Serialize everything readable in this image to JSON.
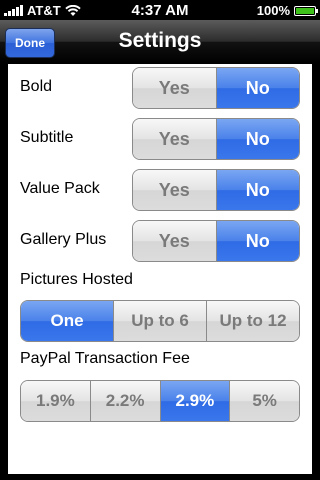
{
  "status_bar": {
    "carrier": "AT&T",
    "time": "4:37 AM",
    "battery": "100%"
  },
  "nav": {
    "title": "Settings",
    "done_label": "Done"
  },
  "options": [
    {
      "label": "Bold",
      "yes": "Yes",
      "no": "No",
      "selected": "No"
    },
    {
      "label": "Subtitle",
      "yes": "Yes",
      "no": "No",
      "selected": "No"
    },
    {
      "label": "Value Pack",
      "yes": "Yes",
      "no": "No",
      "selected": "No"
    },
    {
      "label": "Gallery Plus",
      "yes": "Yes",
      "no": "No",
      "selected": "No"
    }
  ],
  "pictures_hosted": {
    "label": "Pictures Hosted",
    "choices": [
      "One",
      "Up to 6",
      "Up to 12"
    ],
    "selected": "One"
  },
  "paypal_fee": {
    "label": "PayPal Transaction Fee",
    "choices": [
      "1.9%",
      "2.2%",
      "2.9%",
      "5%"
    ],
    "selected": "2.9%"
  },
  "colors": {
    "accent_blue": "#3a77ec",
    "battery_green": "#3ec21b"
  }
}
